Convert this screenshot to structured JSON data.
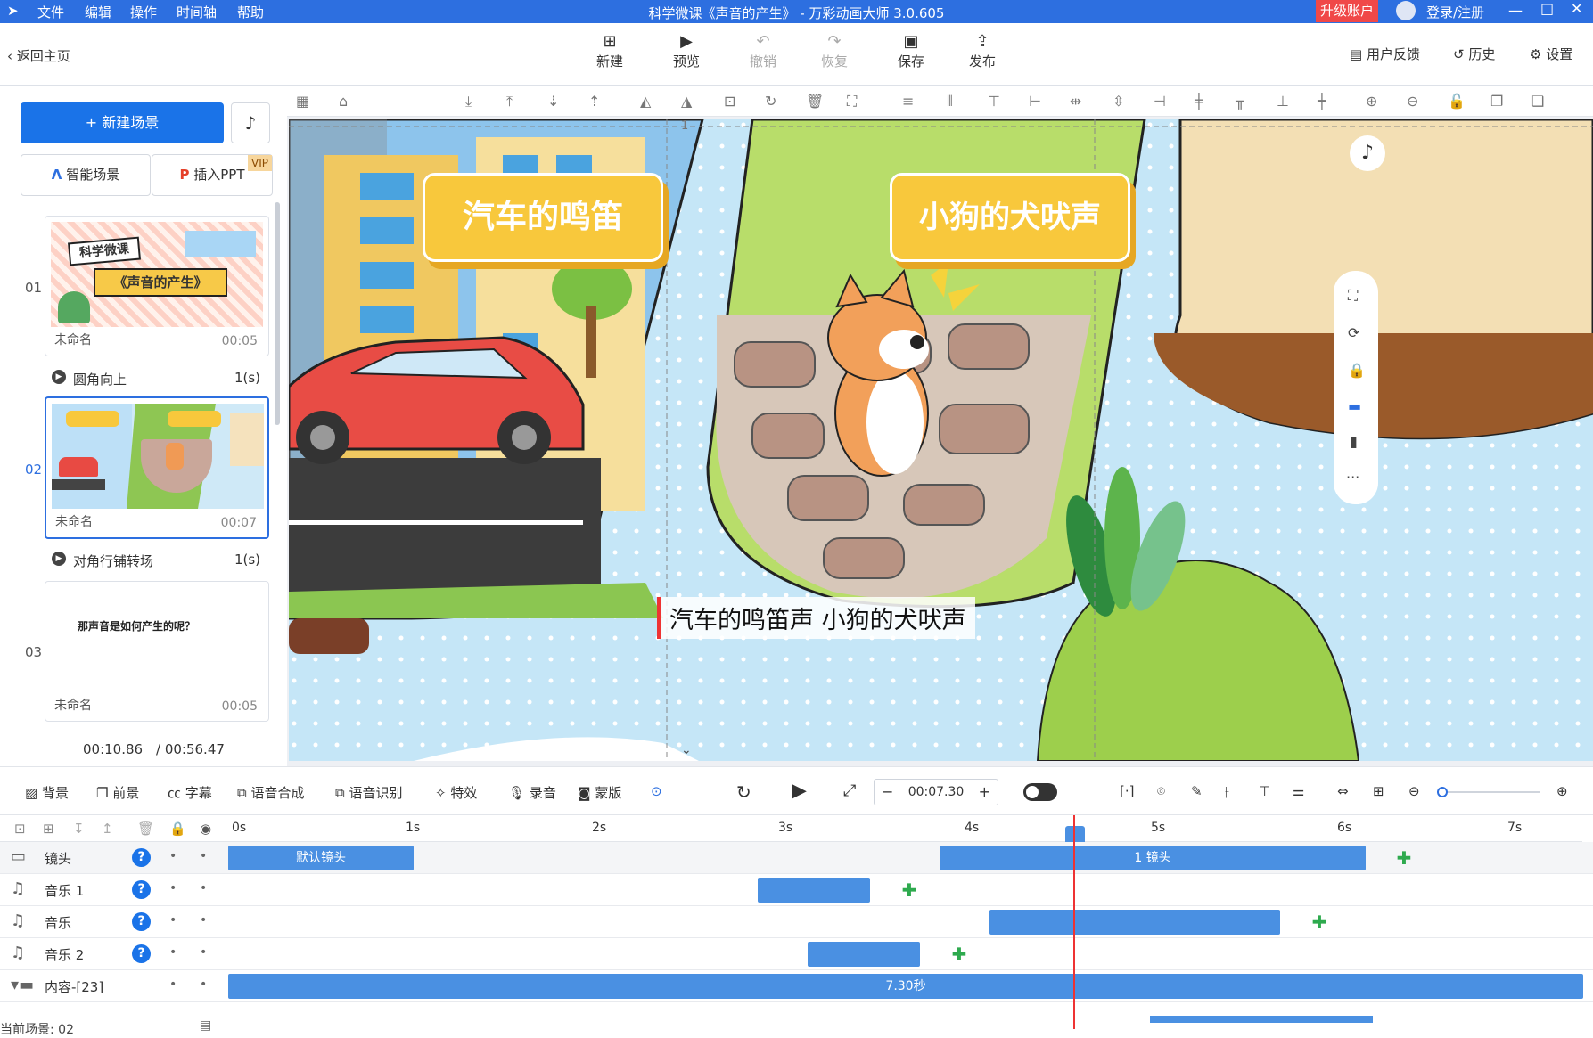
{
  "titlebar": {
    "menu": [
      "文件",
      "编辑",
      "操作",
      "时间轴",
      "帮助"
    ],
    "title": "科学微课《声音的产生》 - 万彩动画大师 3.0.605",
    "upgrade": "升级账户",
    "login": "登录/注册"
  },
  "toolbar": {
    "back": "返回主页",
    "new": "新建",
    "preview": "预览",
    "undo": "撤销",
    "redo": "恢复",
    "save": "保存",
    "publish": "发布",
    "feedback": "用户反馈",
    "history": "历史",
    "settings": "设置"
  },
  "left": {
    "new_scene": "+ 新建场景",
    "smart_scene": "智能场景",
    "insert_ppt": "插入PPT",
    "vip": "VIP",
    "scenes": [
      {
        "num": "01",
        "name": "未命名",
        "time": "00:05",
        "thumb_title": "科学微课",
        "thumb_sub": "《声音的产生》"
      },
      {
        "num": "02",
        "name": "未命名",
        "time": "00:07"
      },
      {
        "num": "03",
        "name": "未命名",
        "time": "00:05",
        "thumb_text": "那声音是如何产生的呢？"
      }
    ],
    "transitions": [
      {
        "name": "圆角向上",
        "dur": "1(s)"
      },
      {
        "name": "对角行铺转场",
        "dur": "1(s)"
      }
    ],
    "time_current": "00:10.86",
    "time_total": "/ 00:56.47",
    "current_scene": "当前场景: 02"
  },
  "canvas": {
    "label_left": "汽车的鸣笛",
    "label_right": "小狗的犬吠声",
    "subtitle": "汽车的鸣笛声 小狗的犬吠声",
    "frame_num": "1"
  },
  "bottom_tools": {
    "items": [
      "背景",
      "前景",
      "字幕",
      "语音合成",
      "语音识别",
      "特效",
      "录音",
      "蒙版"
    ],
    "time": "00:07.30"
  },
  "timeline": {
    "ticks": [
      "0s",
      "1s",
      "2s",
      "3s",
      "4s",
      "5s",
      "6s",
      "7s"
    ],
    "rows": [
      {
        "label": "镜头"
      },
      {
        "label": "音乐 1"
      },
      {
        "label": "音乐"
      },
      {
        "label": "音乐 2"
      },
      {
        "label": "内容-[23]"
      }
    ],
    "clip_default_camera": "默认镜头",
    "clip_camera1": "1 镜头",
    "clip_content": "7.30秒"
  },
  "colors": {
    "accent": "#2d6fe0",
    "clip": "#4a90e2",
    "playhead": "#e33333",
    "label_yellow": "#f8c83c"
  }
}
